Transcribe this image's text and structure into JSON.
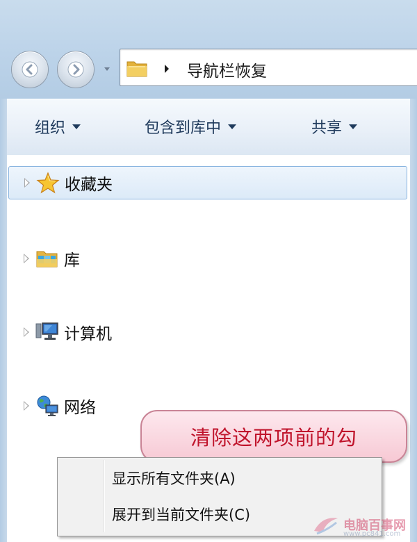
{
  "address_bar": {
    "path": "导航栏恢复"
  },
  "toolbar": {
    "organize": "组织",
    "include_in_library": "包含到库中",
    "share": "共享"
  },
  "nav_pane": {
    "items": [
      {
        "label": "收藏夹",
        "icon": "star-icon",
        "selected": true
      },
      {
        "label": "库",
        "icon": "library-icon"
      },
      {
        "label": "计算机",
        "icon": "computer-icon"
      },
      {
        "label": "网络",
        "icon": "network-icon"
      }
    ]
  },
  "context_menu": {
    "items": [
      {
        "label": "显示所有文件夹(A)"
      },
      {
        "label": "展开到当前文件夹(C)"
      }
    ]
  },
  "callout": {
    "text": "清除这两项前的勾"
  },
  "watermark": {
    "text": "电脑百事网",
    "sub": "www.pc841.com"
  },
  "colors": {
    "frame": "#b3cce4",
    "toolbar_text": "#1e395b",
    "selected_border": "#88b3df",
    "callout_bg": "#f7c9d4",
    "callout_text": "#c0142c"
  }
}
